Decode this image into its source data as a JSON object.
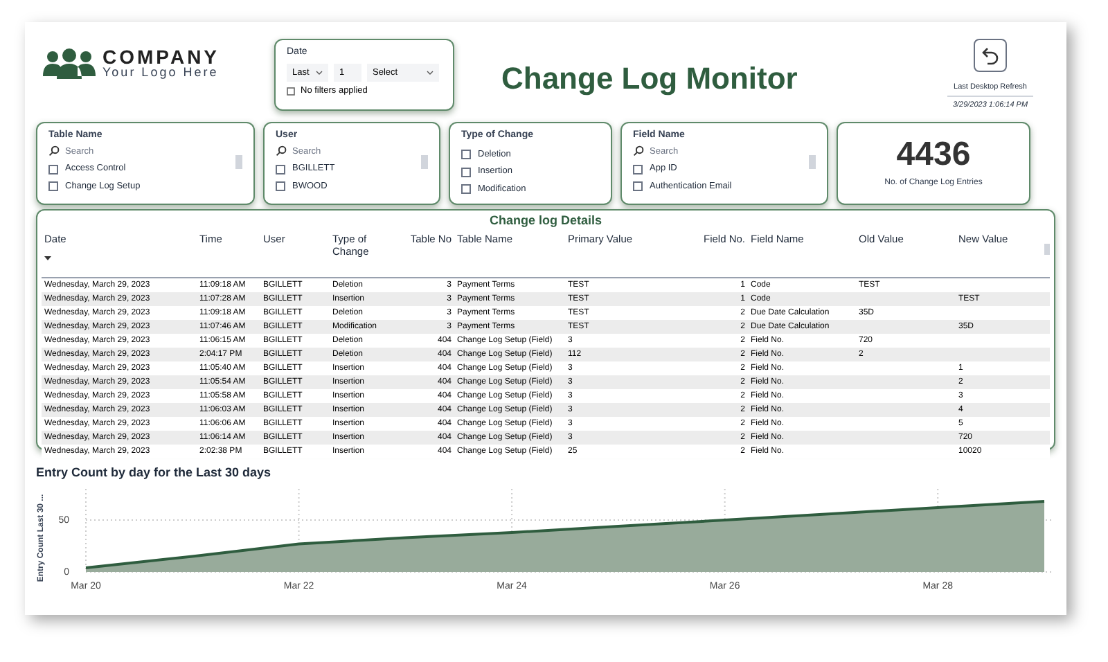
{
  "logo": {
    "name": "COMPANY",
    "tagline": "Your Logo Here"
  },
  "date_filter": {
    "title": "Date",
    "period": "Last",
    "count": "1",
    "unit": "Select",
    "status": "No filters applied"
  },
  "title": "Change Log Monitor",
  "refresh": {
    "label": "Last Desktop Refresh",
    "timestamp": "3/29/2023 1:06:14 PM"
  },
  "slicers": [
    {
      "title": "Table Name",
      "placeholder": "Search",
      "items": [
        {
          "label": "Access Control",
          "checked": false
        },
        {
          "label": "Change Log Setup",
          "checked": false
        }
      ]
    },
    {
      "title": "User",
      "placeholder": "Search",
      "items": [
        {
          "label": "BGILLETT",
          "checked": false
        },
        {
          "label": "BWOOD",
          "checked": false
        }
      ]
    },
    {
      "title": "Type of Change",
      "items": [
        {
          "label": "Deletion",
          "checked": false
        },
        {
          "label": "Insertion",
          "checked": false
        },
        {
          "label": "Modification",
          "checked": false
        }
      ]
    },
    {
      "title": "Field Name",
      "placeholder": "Search",
      "items": [
        {
          "label": "App ID",
          "checked": false
        },
        {
          "label": "Authentication Email",
          "checked": false
        }
      ]
    }
  ],
  "kpi": {
    "value": "4436",
    "label": "No. of Change Log Entries"
  },
  "table": {
    "title": "Change log Details",
    "columns": [
      "Date",
      "Time",
      "User",
      "Type of Change",
      "Table No",
      "Table Name",
      "Primary Value",
      "Field No.",
      "Field Name",
      "Old Value",
      "New Value"
    ],
    "rows": [
      [
        "Wednesday, March 29, 2023",
        "11:09:18 AM",
        "BGILLETT",
        "Deletion",
        "3",
        "Payment Terms",
        "TEST",
        "1",
        "Code",
        "TEST",
        ""
      ],
      [
        "Wednesday, March 29, 2023",
        "11:07:28 AM",
        "BGILLETT",
        "Insertion",
        "3",
        "Payment Terms",
        "TEST",
        "1",
        "Code",
        "",
        "TEST"
      ],
      [
        "Wednesday, March 29, 2023",
        "11:09:18 AM",
        "BGILLETT",
        "Deletion",
        "3",
        "Payment Terms",
        "TEST",
        "2",
        "Due Date Calculation",
        "35D",
        ""
      ],
      [
        "Wednesday, March 29, 2023",
        "11:07:46 AM",
        "BGILLETT",
        "Modification",
        "3",
        "Payment Terms",
        "TEST",
        "2",
        "Due Date Calculation",
        "",
        "35D"
      ],
      [
        "Wednesday, March 29, 2023",
        "11:06:15 AM",
        "BGILLETT",
        "Deletion",
        "404",
        "Change Log Setup (Field)",
        "3",
        "2",
        "Field No.",
        "720",
        ""
      ],
      [
        "Wednesday, March 29, 2023",
        "2:04:17 PM",
        "BGILLETT",
        "Deletion",
        "404",
        "Change Log Setup (Field)",
        "112",
        "2",
        "Field No.",
        "2",
        ""
      ],
      [
        "Wednesday, March 29, 2023",
        "11:05:40 AM",
        "BGILLETT",
        "Insertion",
        "404",
        "Change Log Setup (Field)",
        "3",
        "2",
        "Field No.",
        "",
        "1"
      ],
      [
        "Wednesday, March 29, 2023",
        "11:05:54 AM",
        "BGILLETT",
        "Insertion",
        "404",
        "Change Log Setup (Field)",
        "3",
        "2",
        "Field No.",
        "",
        "2"
      ],
      [
        "Wednesday, March 29, 2023",
        "11:05:58 AM",
        "BGILLETT",
        "Insertion",
        "404",
        "Change Log Setup (Field)",
        "3",
        "2",
        "Field No.",
        "",
        "3"
      ],
      [
        "Wednesday, March 29, 2023",
        "11:06:03 AM",
        "BGILLETT",
        "Insertion",
        "404",
        "Change Log Setup (Field)",
        "3",
        "2",
        "Field No.",
        "",
        "4"
      ],
      [
        "Wednesday, March 29, 2023",
        "11:06:06 AM",
        "BGILLETT",
        "Insertion",
        "404",
        "Change Log Setup (Field)",
        "3",
        "2",
        "Field No.",
        "",
        "5"
      ],
      [
        "Wednesday, March 29, 2023",
        "11:06:14 AM",
        "BGILLETT",
        "Insertion",
        "404",
        "Change Log Setup (Field)",
        "3",
        "2",
        "Field No.",
        "",
        "720"
      ],
      [
        "Wednesday, March 29, 2023",
        "2:02:38 PM",
        "BGILLETT",
        "Insertion",
        "404",
        "Change Log Setup (Field)",
        "25",
        "2",
        "Field No.",
        "",
        "10020"
      ]
    ]
  },
  "chart_section": {
    "title": "Entry Count by day for the Last 30 days",
    "chart_data": {
      "type": "area",
      "ylabel": "Entry Count Last 30 ...",
      "categories": [
        "Mar 20",
        null,
        "Mar 22",
        null,
        "Mar 24",
        null,
        "Mar 26",
        null,
        "Mar 28",
        null
      ],
      "grid": true,
      "series": [
        {
          "color": "#2f5d3f",
          "values": [
            4,
            15,
            27,
            33,
            38,
            44,
            50,
            56,
            62,
            68
          ]
        }
      ],
      "ylim": [
        0,
        80
      ],
      "yticks": [
        0,
        50
      ]
    }
  }
}
